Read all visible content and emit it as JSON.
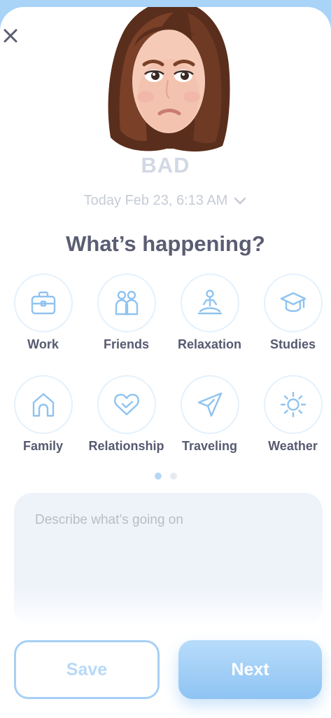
{
  "mood": {
    "label": "BAD"
  },
  "date": {
    "text": "Today Feb 23, 6:13 AM"
  },
  "title": "What’s happening?",
  "categories": [
    {
      "label": "Work",
      "icon": "briefcase-icon"
    },
    {
      "label": "Friends",
      "icon": "friends-icon"
    },
    {
      "label": "Relaxation",
      "icon": "meditation-icon"
    },
    {
      "label": "Studies",
      "icon": "graduation-cap-icon"
    },
    {
      "label": "Family",
      "icon": "home-icon"
    },
    {
      "label": "Relationship",
      "icon": "heart-icon"
    },
    {
      "label": "Traveling",
      "icon": "paper-plane-icon"
    },
    {
      "label": "Weather",
      "icon": "sun-icon"
    }
  ],
  "pagination": {
    "pages": 2,
    "current": 1
  },
  "description": {
    "placeholder": "Describe what’s going on",
    "value": ""
  },
  "buttons": {
    "save": "Save",
    "next": "Next"
  },
  "colors": {
    "accent": "#8ec3f3",
    "icon": "#8fc3f0",
    "title_text": "#5b5d73",
    "muted_text": "#c6cbd6"
  }
}
